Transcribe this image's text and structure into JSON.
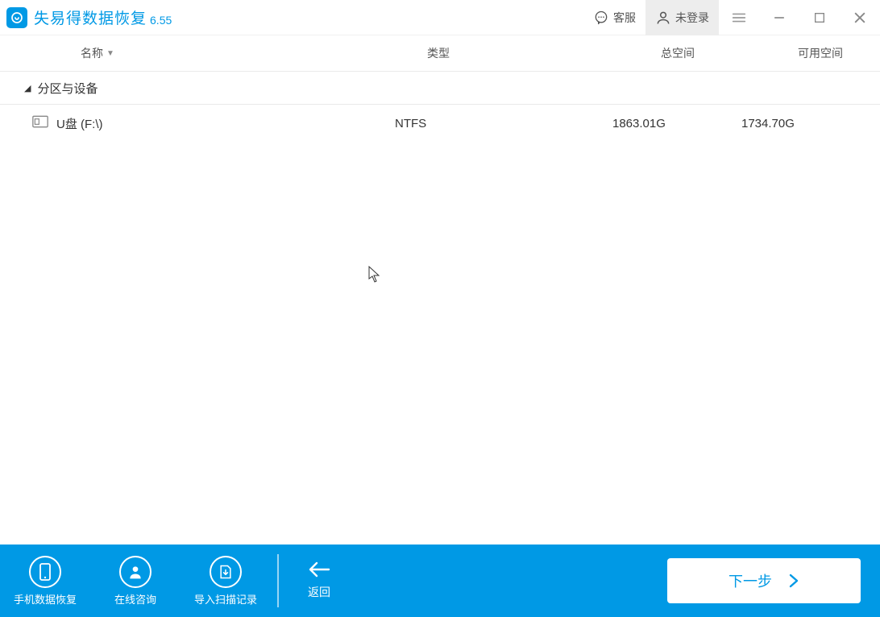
{
  "titlebar": {
    "app_name": "失易得数据恢复",
    "version": "6.55",
    "support_label": "客服",
    "login_label": "未登录"
  },
  "table": {
    "headers": {
      "name": "名称",
      "type": "类型",
      "total": "总空间",
      "free": "可用空间"
    },
    "section_label": "分区与设备",
    "rows": [
      {
        "name": "U盘 (F:\\)",
        "type": "NTFS",
        "total": "1863.01G",
        "free": "1734.70G"
      }
    ]
  },
  "bottom": {
    "phone_recovery": "手机数据恢复",
    "online_consult": "在线咨询",
    "import_scan": "导入扫描记录",
    "back": "返回",
    "next": "下一步"
  }
}
